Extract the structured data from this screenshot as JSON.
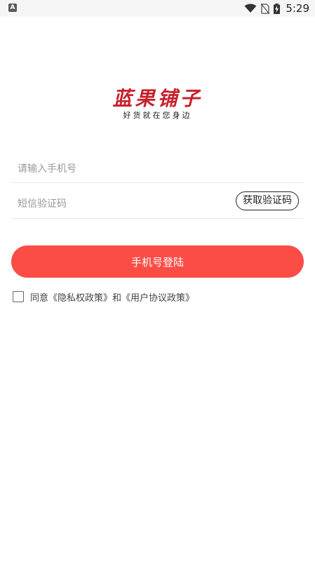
{
  "status_bar": {
    "notification_icon_label": "A",
    "time": "5:29",
    "icons": [
      "wifi-icon",
      "no-sim-icon",
      "battery-charging-icon"
    ]
  },
  "logo": {
    "title": "蓝果铺子",
    "slogan": "好货就在您身边"
  },
  "form": {
    "phone_placeholder": "请输入手机号",
    "code_placeholder": "短信验证码",
    "get_code_label": "获取验证码",
    "login_label": "手机号登陆"
  },
  "agreement": {
    "prefix": "同意",
    "privacy_link": "《隐私权政策》",
    "conjunction": "和",
    "user_link": "《用户协议政策》"
  },
  "colors": {
    "primary": "#fb4d46",
    "logo": "#c8202a"
  }
}
